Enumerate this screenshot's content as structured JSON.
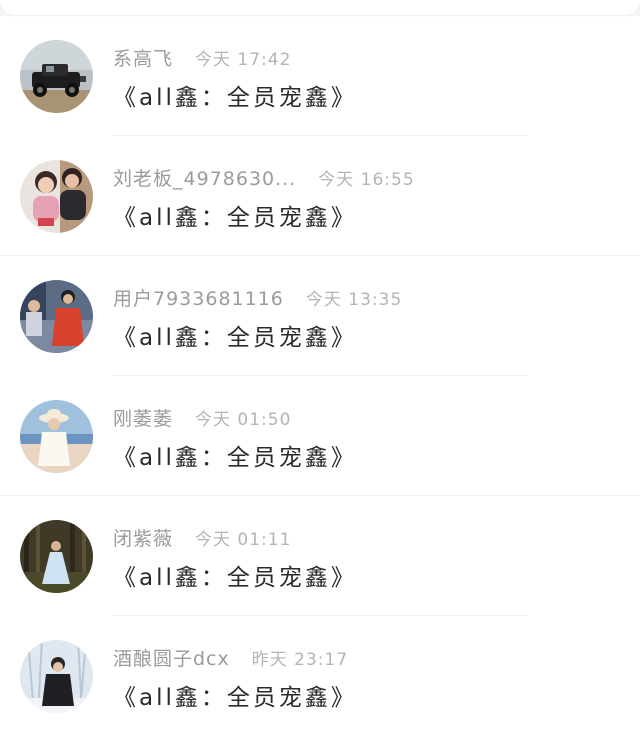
{
  "comments": [
    {
      "username": "系高飞",
      "time": "今天 17:42",
      "text": "《all鑫：全员宠鑫》",
      "avatar_icon": "vintage-car-photo"
    },
    {
      "username": "刘老板_4978630...",
      "time": "今天 16:55",
      "text": "《all鑫：全员宠鑫》",
      "avatar_icon": "two-girls-photo"
    },
    {
      "username": "用户7933681116",
      "time": "今天 13:35",
      "text": "《all鑫：全员宠鑫》",
      "avatar_icon": "red-coat-photo"
    },
    {
      "username": "刚萎萎",
      "time": "今天 01:50",
      "text": "《all鑫：全员宠鑫》",
      "avatar_icon": "sun-hat-girl-photo"
    },
    {
      "username": "闭紫薇",
      "time": "今天 01:11",
      "text": "《all鑫：全员宠鑫》",
      "avatar_icon": "forest-dress-photo"
    },
    {
      "username": "酒酿圆子dcx",
      "time": "昨天 23:17",
      "text": "《all鑫：全员宠鑫》",
      "avatar_icon": "winter-boy-photo"
    }
  ]
}
